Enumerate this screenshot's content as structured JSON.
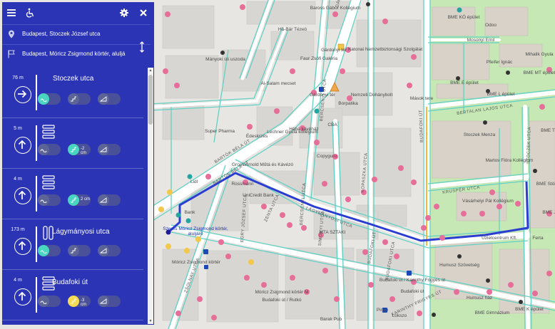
{
  "panel": {
    "accent": "#2a34b5",
    "toolbar": {
      "menu_icon": "hamburger-icon",
      "accessibility_icon": "wheelchair-icon",
      "settings_icon": "gear-icon",
      "close_icon": "close-icon"
    },
    "origin": "Budapest, Stoczek József utca",
    "destination": "Budapest, Móricz Zsigmond körtér, aluljá",
    "steps": [
      {
        "distance": "76 m",
        "name": "Stoczek utca",
        "turn": "right-arrow-icon",
        "slope": ""
      },
      {
        "distance": "5 m",
        "name": "",
        "turn": "up-arrow-icon",
        "slope": "-2 cm"
      },
      {
        "distance": "4 m",
        "name": "",
        "turn": "up-arrow-icon",
        "slope": "2 cm"
      },
      {
        "distance": "173 m",
        "name": "Lágymányosi utca",
        "turn": "up-arrow-icon",
        "slope": ""
      },
      {
        "distance": "4 m",
        "name": "Budafoki út",
        "turn": "up-arrow-icon",
        "slope": "-3 cm"
      }
    ]
  },
  "map": {
    "route_color": "#2c3ed1",
    "destination_label": "Szeres Móricz Zsigmond körtér, aluljáró",
    "places": [
      {
        "t": "Baross Gábor Kollégium"
      },
      {
        "t": "BME KÓ épület"
      },
      {
        "t": "Odoo"
      },
      {
        "t": "Mosonyi Emil"
      },
      {
        "t": "Mihalik Gyula"
      },
      {
        "t": "Pfeifer Ignác"
      },
      {
        "t": "BME MT épület"
      },
      {
        "t": "BME E épület"
      },
      {
        "t": "BME L épület"
      },
      {
        "t": "Há-Bár Tézeö"
      },
      {
        "t": "Gárdonyi tér"
      },
      {
        "t": "Faur Zsófi Galéria"
      },
      {
        "t": "Katonai Nemzetbiztonsági Szolgálat"
      },
      {
        "t": "Mányoki úti uszoda"
      },
      {
        "t": "Al-Salam mecset"
      },
      {
        "t": "Gárdonyi tér"
      },
      {
        "t": "Nemzeti Dohánybolt"
      },
      {
        "t": "Mások tere"
      },
      {
        "t": "Borpatika"
      },
      {
        "t": "Hábá kávéház"
      },
      {
        "t": "CBA"
      },
      {
        "t": "Super Pharma"
      },
      {
        "t": "Édeskrzés"
      },
      {
        "t": "Lechner Gyula kollégium"
      },
      {
        "t": "Copyguru"
      },
      {
        "t": "Gross Arnold Műtá és Kávézó"
      },
      {
        "t": "Stoczek Menza"
      },
      {
        "t": "Martos Flóra Kollégium"
      },
      {
        "t": "Lidl"
      },
      {
        "t": "Rossmann"
      },
      {
        "t": "UniCredit Bank"
      },
      {
        "t": "Vásárhelyi Pál Kollégium"
      },
      {
        "t": "Bank"
      },
      {
        "t": "MTA SZTAKI"
      },
      {
        "t": "Üzletcentrum Kft."
      },
      {
        "t": "Ferta"
      },
      {
        "t": "Móricz Zsigmond körtér"
      },
      {
        "t": "Humusz Szövetség"
      },
      {
        "t": "Humusz ház"
      },
      {
        "t": "Budafoki út / Karinthy Frigyes út"
      },
      {
        "t": "Budafoki út"
      },
      {
        "t": "Móricz Zsigmond körtér M"
      },
      {
        "t": "Budafoki út / Rutkó"
      },
      {
        "t": "Barak Pub"
      },
      {
        "t": "Pinyo"
      },
      {
        "t": "Lokszo"
      },
      {
        "t": "BME Gimnázium"
      },
      {
        "t": "BME K épület"
      },
      {
        "t": "BME Stöhtl"
      },
      {
        "t": "BME J"
      },
      {
        "t": "BME T"
      }
    ],
    "streets": [
      "BARTÓK BÉLA ÚT",
      "BARTÓK BÉLA ÚT",
      "GÁRDONYI TÉR",
      "LÁGYMÁNYOSI UTCA",
      "KOPASZKA UTCA",
      "SIMONYI UTCA",
      "BUDAFOKI ÚT",
      "BERTALAN LAJOS UTCA",
      "STOCZEK UTCA",
      "KRUSPÉR UTCA",
      "BERCSÉNYI UTCA",
      "ZENTA UTCA",
      "BUDAFOKI ÚT",
      "BUDAFOKI UTCA",
      "ZSOLNAY UTCA",
      "KARINTHY FRIGYES ÚT",
      "BERCSÉNYI UTCA",
      "EGRY JÓZSEF UTCA"
    ]
  }
}
